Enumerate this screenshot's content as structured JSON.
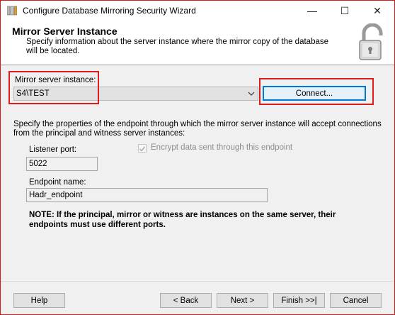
{
  "window": {
    "title": "Configure Database Mirroring Security Wizard",
    "controls": {
      "minimize": "—",
      "maximize": "☐",
      "close": "✕"
    }
  },
  "header": {
    "title": "Mirror Server Instance",
    "description": "Specify information about the server instance where the mirror copy of the database will be located.",
    "icon": "lock-icon"
  },
  "mirror": {
    "label": "Mirror server instance:",
    "value": "S4\\TEST",
    "connect_label": "Connect..."
  },
  "instructions": "Specify the properties of the endpoint through which the mirror server instance will accept connections from the principal and witness server instances:",
  "listener": {
    "label": "Listener port:",
    "value": "5022"
  },
  "encrypt": {
    "label": "Encrypt data sent through this endpoint",
    "checked": true,
    "enabled": false
  },
  "endpoint": {
    "label": "Endpoint name:",
    "value": "Hadr_endpoint"
  },
  "note": "NOTE: If the principal, mirror or witness are instances on the same server, their endpoints must use different ports.",
  "footer": {
    "help": "Help",
    "back": "< Back",
    "next": "Next >",
    "finish": "Finish >>|",
    "cancel": "Cancel"
  },
  "colors": {
    "highlight": "#e01b1b",
    "focus": "#0078d7"
  }
}
